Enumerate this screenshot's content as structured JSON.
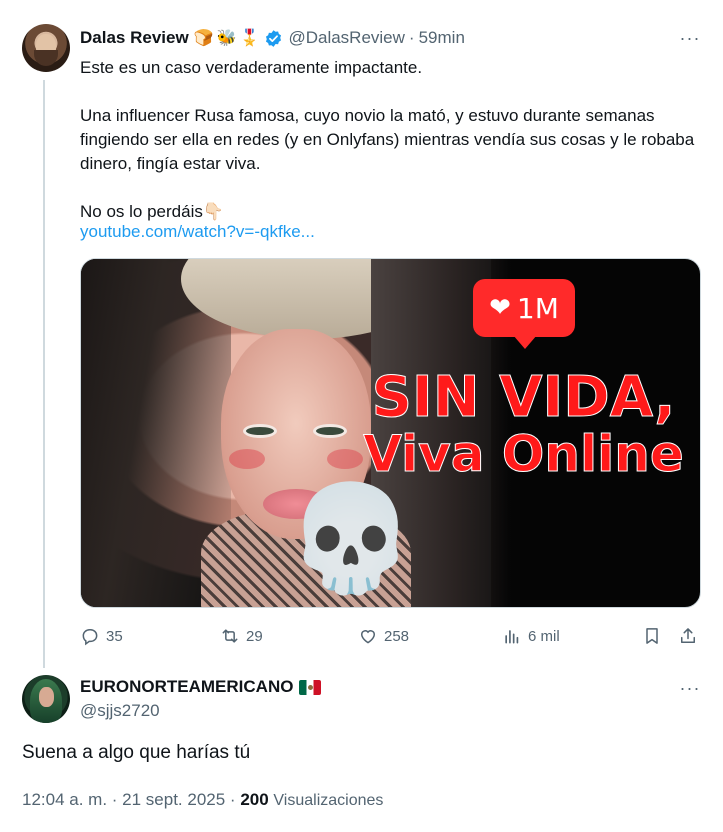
{
  "tweet": {
    "author_name": "Dalas Review",
    "author_emojis": [
      "🍞",
      "🐝",
      "🎖️"
    ],
    "handle": "@DalasReview",
    "separator": "·",
    "time": "59min",
    "more_glyph": "···",
    "text": "Este es un caso verdaderamente impactante.\n\nUna influencer Rusa famosa, cuyo novio la mató, y estuvo durante semanas fingiendo ser ella en redes (y en Onlyfans) mientras vendía sus cosas y le robaba dinero, fingía estar viva.\n\nNo os lo perdáis👇🏻",
    "link": "youtube.com/watch?v=-qkfke...",
    "thumbnail": {
      "badge_icon": "heart-icon",
      "badge_heart": "❤",
      "badge_count": "1M",
      "headline_line1": "SIN VIDA,",
      "headline_line2": "Viva Online",
      "emoji": "💀"
    },
    "actions": {
      "replies": "35",
      "retweets": "29",
      "likes": "258",
      "views": "6 mil"
    }
  },
  "reply": {
    "author_name": "EURONORTEAMERICANO",
    "flag_icon": "mexico-flag-icon",
    "handle": "@sjjs2720",
    "more_glyph": "···",
    "text": "Suena a algo que harías tú",
    "timestamp": "12:04 a. m. · 21 sept. 2025 ·",
    "views_count": "200",
    "views_label": "Visualizaciones"
  },
  "colors": {
    "accent": "#1d9bf0",
    "muted": "#536471",
    "text": "#0f1419",
    "thumbnail_red": "#ff1a1a"
  }
}
